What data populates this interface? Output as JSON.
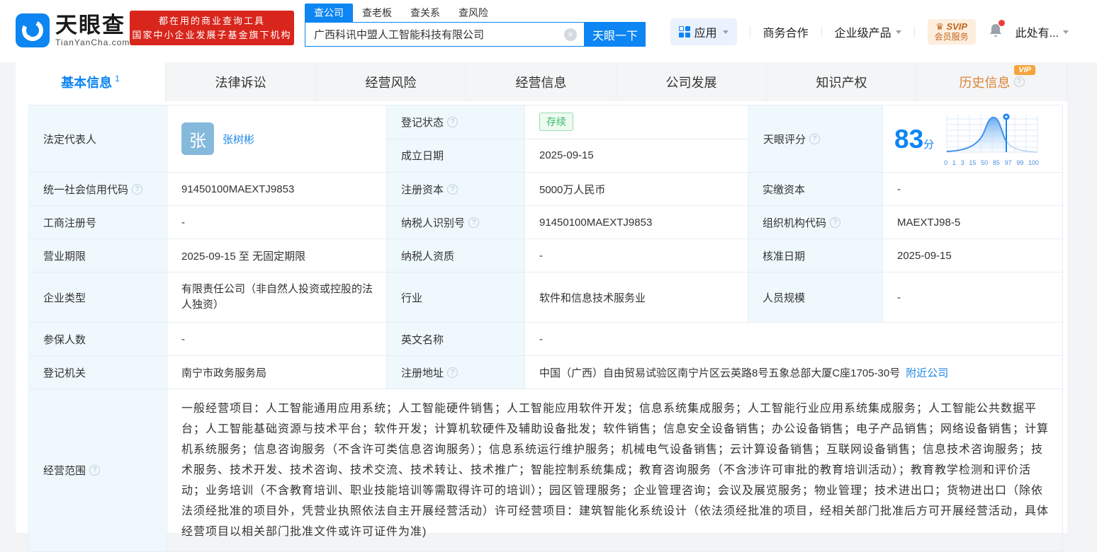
{
  "brand": {
    "name": "天眼查",
    "domain": "TianYanCha.com",
    "slogan_line1": "都在用的商业查询工具",
    "slogan_line2": "国家中小企业发展子基金旗下机构"
  },
  "search": {
    "tabs": {
      "t0": "查公司",
      "t1": "查老板",
      "t2": "查关系",
      "t3": "查风险"
    },
    "value": "广西科讯中盟人工智能科技有限公司",
    "button": "天眼一下"
  },
  "nav": {
    "apps": "应用",
    "cooperation": "商务合作",
    "enterprise": "企业级产品",
    "svip_top": "SVIP",
    "svip_bottom": "会员服务",
    "more": "此处有..."
  },
  "tabs": {
    "t0": "基本信息",
    "t0_count": "1",
    "t1": "法律诉讼",
    "t2": "经营风险",
    "t3": "经营信息",
    "t4": "公司发展",
    "t5": "知识产权",
    "t6": "历史信息",
    "t6_badge": "VIP"
  },
  "table": {
    "legal_rep_label": "法定代表人",
    "legal_rep_avatar": "张",
    "legal_rep_name": "张树彬",
    "reg_status_label": "登记状态",
    "reg_status_value": "存续",
    "est_date_label": "成立日期",
    "est_date_value": "2025-09-15",
    "score_label": "天眼评分",
    "score_value": "83",
    "score_unit": "分",
    "uscc_label": "统一社会信用代码",
    "uscc_value": "91450100MAEXTJ9853",
    "reg_capital_label": "注册资本",
    "reg_capital_value": "5000万人民币",
    "paid_capital_label": "实缴资本",
    "paid_capital_value": "-",
    "reg_number_label": "工商注册号",
    "reg_number_value": "-",
    "taxpayer_id_label": "纳税人识别号",
    "taxpayer_id_value": "91450100MAEXTJ9853",
    "org_code_label": "组织机构代码",
    "org_code_value": "MAEXTJ98-5",
    "biz_term_label": "营业期限",
    "biz_term_value": "2025-09-15 至 无固定期限",
    "taxpayer_qual_label": "纳税人资质",
    "taxpayer_qual_value": "-",
    "approval_date_label": "核准日期",
    "approval_date_value": "2025-09-15",
    "company_type_label": "企业类型",
    "company_type_value": "有限责任公司（非自然人投资或控股的法人独资）",
    "industry_label": "行业",
    "industry_value": "软件和信息技术服务业",
    "staff_size_label": "人员规模",
    "staff_size_value": "-",
    "insured_label": "参保人数",
    "insured_value": "-",
    "english_name_label": "英文名称",
    "english_name_value": "-",
    "reg_authority_label": "登记机关",
    "reg_authority_value": "南宁市政务服务局",
    "address_label": "注册地址",
    "address_value": "中国（广西）自由贸易试验区南宁片区云英路8号五象总部大厦C座1705-30号",
    "address_link": "附近公司",
    "scope_label": "经营范围",
    "scope_value": "一般经营项目：人工智能通用应用系统；人工智能硬件销售；人工智能应用软件开发；信息系统集成服务；人工智能行业应用系统集成服务；人工智能公共数据平台；人工智能基础资源与技术平台；软件开发；计算机软硬件及辅助设备批发；软件销售；信息安全设备销售；办公设备销售；电子产品销售；网络设备销售；计算机系统服务；信息咨询服务（不含许可类信息咨询服务）；信息系统运行维护服务；机械电气设备销售；云计算设备销售；互联网设备销售；信息技术咨询服务；技术服务、技术开发、技术咨询、技术交流、技术转让、技术推广；智能控制系统集成；教育咨询服务（不含涉许可审批的教育培训活动）；教育教学检测和评价活动；业务培训（不含教育培训、职业技能培训等需取得许可的培训）；园区管理服务；企业管理咨询；会议及展览服务；物业管理；技术进出口；货物进出口（除依法须经批准的项目外，凭营业执照依法自主开展经营活动）许可经营项目：建筑智能化系统设计（依法须经批准的项目，经相关部门批准后方可开展经营活动，具体经营项目以相关部门批准文件或许可证件为准)"
  },
  "chart_data": {
    "type": "area",
    "title": "天眼评分分布曲线",
    "xticklabels": [
      "0",
      "1",
      "3",
      "15",
      "50",
      "85",
      "97",
      "99",
      "100"
    ],
    "marker_value": 83,
    "peak_near_tick": "50",
    "legend_position": "none",
    "grid": true
  },
  "icons": {
    "help": "?",
    "clear": "×",
    "crown": "♛"
  },
  "colors": {
    "primary_blue": "#0d85f2",
    "link_blue": "#2289e6",
    "brand_red": "#d8261d",
    "label_bg": "#eff8fd",
    "green_status": "#3cb96a",
    "history_orange": "#dc8435",
    "vip_badge": "#f5a43d",
    "notify_red": "#f23c3c"
  }
}
